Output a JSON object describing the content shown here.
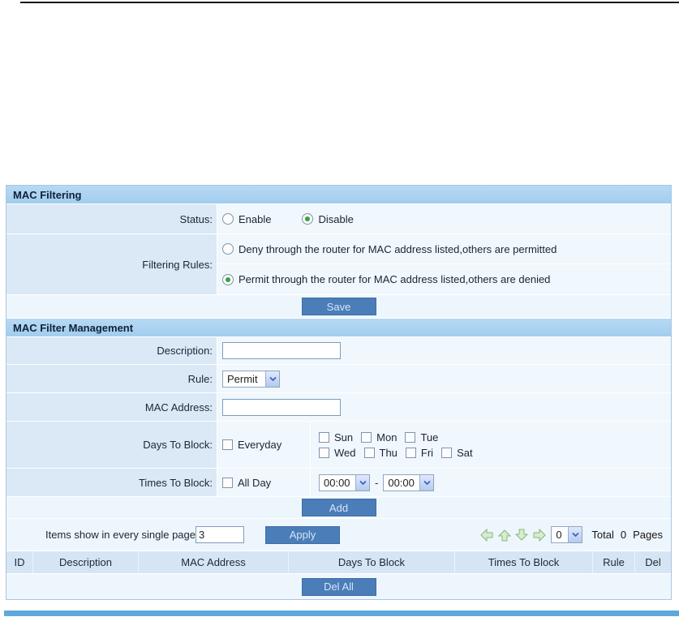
{
  "mac_filtering": {
    "title": "MAC Filtering",
    "status_label": "Status:",
    "status_options": [
      {
        "label": "Enable",
        "checked": false
      },
      {
        "label": "Disable",
        "checked": true
      }
    ],
    "filtering_rules_label": "Filtering Rules:",
    "rules": [
      {
        "label": "Deny through the router for MAC address listed,others are permitted",
        "checked": false
      },
      {
        "label": "Permit through the router for MAC address listed,others are denied",
        "checked": true
      }
    ],
    "save_label": "Save"
  },
  "mac_filter_management": {
    "title": "MAC Filter Management",
    "description_label": "Description:",
    "description_value": "",
    "rule_label": "Rule:",
    "rule_value": "Permit",
    "mac_address_label": "MAC Address:",
    "mac_address_value": "",
    "days_label": "Days To Block:",
    "everyday_label": "Everyday",
    "days_row1": [
      "Sun",
      "Mon",
      "Tue"
    ],
    "days_row2": [
      "Wed",
      "Thu",
      "Fri",
      "Sat"
    ],
    "times_label": "Times To Block:",
    "all_day_label": "All Day",
    "time_from": "00:00",
    "time_separator": "-",
    "time_to": "00:00",
    "add_label": "Add"
  },
  "pagination": {
    "items_text": "Items show in every single page",
    "items_value": "3",
    "apply_label": "Apply",
    "page_select_value": "0",
    "total_prefix": "Total",
    "total_count": "0",
    "total_suffix": "Pages"
  },
  "table": {
    "headers": [
      "ID",
      "Description",
      "MAC Address",
      "Days To Block",
      "Times To Block",
      "Rule",
      "Del"
    ],
    "del_all_label": "Del All"
  },
  "colors": {
    "button_bg": "#4b7db8",
    "section_header_bg": "#a9d2f0",
    "label_cell_bg": "#dbe8f5",
    "content_cell_bg": "#f0f7fd",
    "bottom_bar": "#60a8db",
    "pager_arrow_green": "#d8ecd1",
    "radio_checked_green": "#33a53d"
  }
}
